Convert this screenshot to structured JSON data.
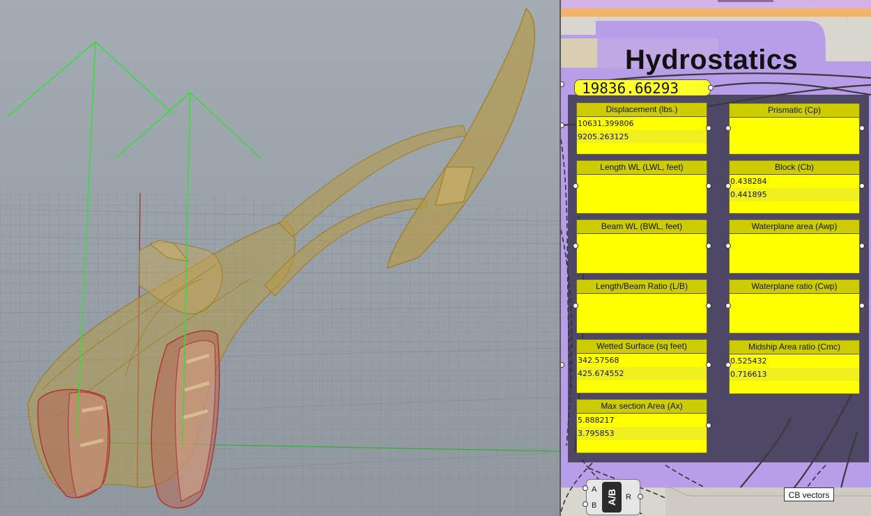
{
  "canvas": {
    "group_title": "Hydrostatics",
    "number_slider_value": "19836.66293",
    "panels": {
      "displacement": {
        "title": "Displacement (lbs.)",
        "lines": [
          "10631.399806",
          "9205.263125"
        ]
      },
      "prismatic": {
        "title": "Prismatic (Cp)",
        "lines": []
      },
      "length_wl": {
        "title": "Length WL (LWL, feet)",
        "lines": []
      },
      "block": {
        "title": "Block (Cb)",
        "lines": [
          "0.438284",
          "0.441895"
        ]
      },
      "beam_wl": {
        "title": "Beam WL (BWL, feet)",
        "lines": []
      },
      "waterplane_area": {
        "title": "Waterplane area (Awp)",
        "lines": []
      },
      "length_beam_ratio": {
        "title": "Length/Beam Ratio (L/B)",
        "lines": []
      },
      "waterplane_ratio": {
        "title": "Waterplane ratio (Cwp)",
        "lines": []
      },
      "wetted_surface": {
        "title": "Wetted Surface (sq feet)",
        "lines": [
          "342.57568",
          "425.674552"
        ]
      },
      "midship_area_ratio": {
        "title": "Midship Area ratio (Cmc)",
        "lines": [
          "0.525432",
          "0.716613"
        ]
      },
      "max_section_area": {
        "title": "Max section Area (Ax)",
        "lines": [
          "5.888217",
          "3.795853"
        ]
      }
    },
    "ab_component": {
      "input_a": "A",
      "input_b": "B",
      "core": "A/B",
      "output": "R"
    },
    "cb_vectors_label": "CB vectors"
  },
  "colors": {
    "panel_yellow": "#ffff00",
    "group_purple": "#b79be8",
    "group_dark": "#4e4866",
    "viewport_bg": "#9aa3ab",
    "hull_gold": "#b59a4a",
    "section_red": "#b0302a",
    "vector_green": "#33e033"
  }
}
